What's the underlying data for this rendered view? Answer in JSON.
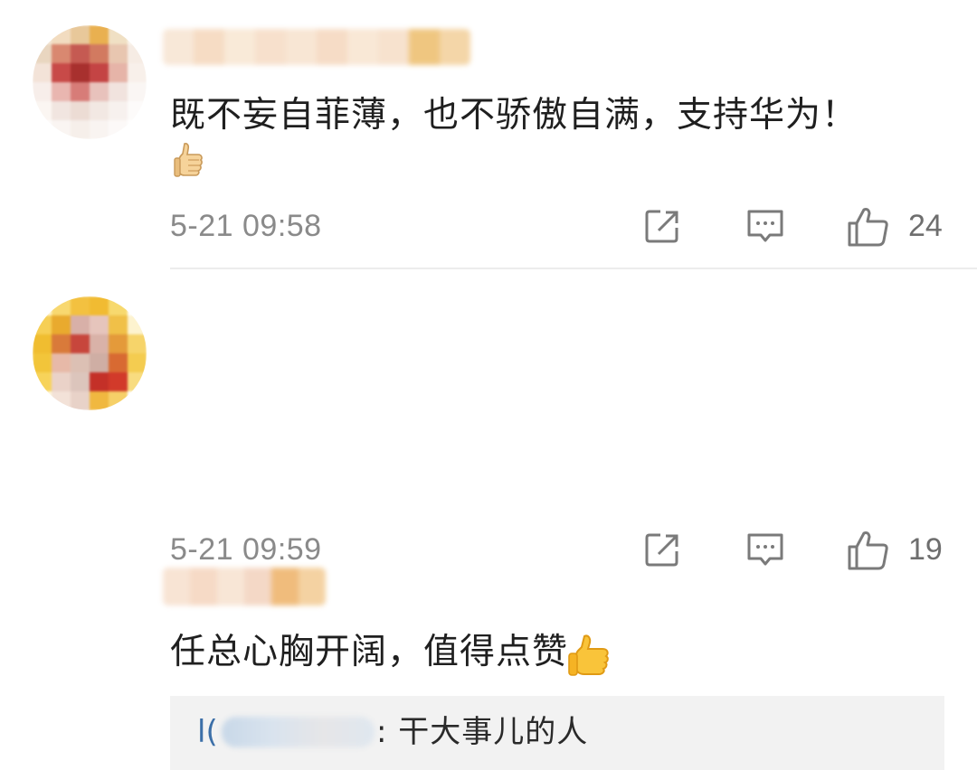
{
  "comments": [
    {
      "text": "既不妄自菲薄，也不骄傲自满，支持华为！",
      "emoji": "thumbs-up",
      "timestamp": "5-21 09:58",
      "like_count": "24"
    },
    {
      "text": "任总心胸开阔，值得点赞",
      "emoji": "thumbs-up",
      "timestamp": "5-21 09:59",
      "like_count": "19",
      "reply": {
        "user_visible_prefix": "l(",
        "text": ": 干大事儿的人"
      }
    }
  ],
  "icons": {
    "share": "share-icon",
    "reply": "comment-icon",
    "like": "like-icon"
  },
  "colors": {
    "timestamp": "#8a8a8a",
    "icon": "#7a7a7a",
    "reply_bg": "#f2f2f2",
    "reply_user": "#3c6fa8",
    "divider": "#ececec"
  }
}
